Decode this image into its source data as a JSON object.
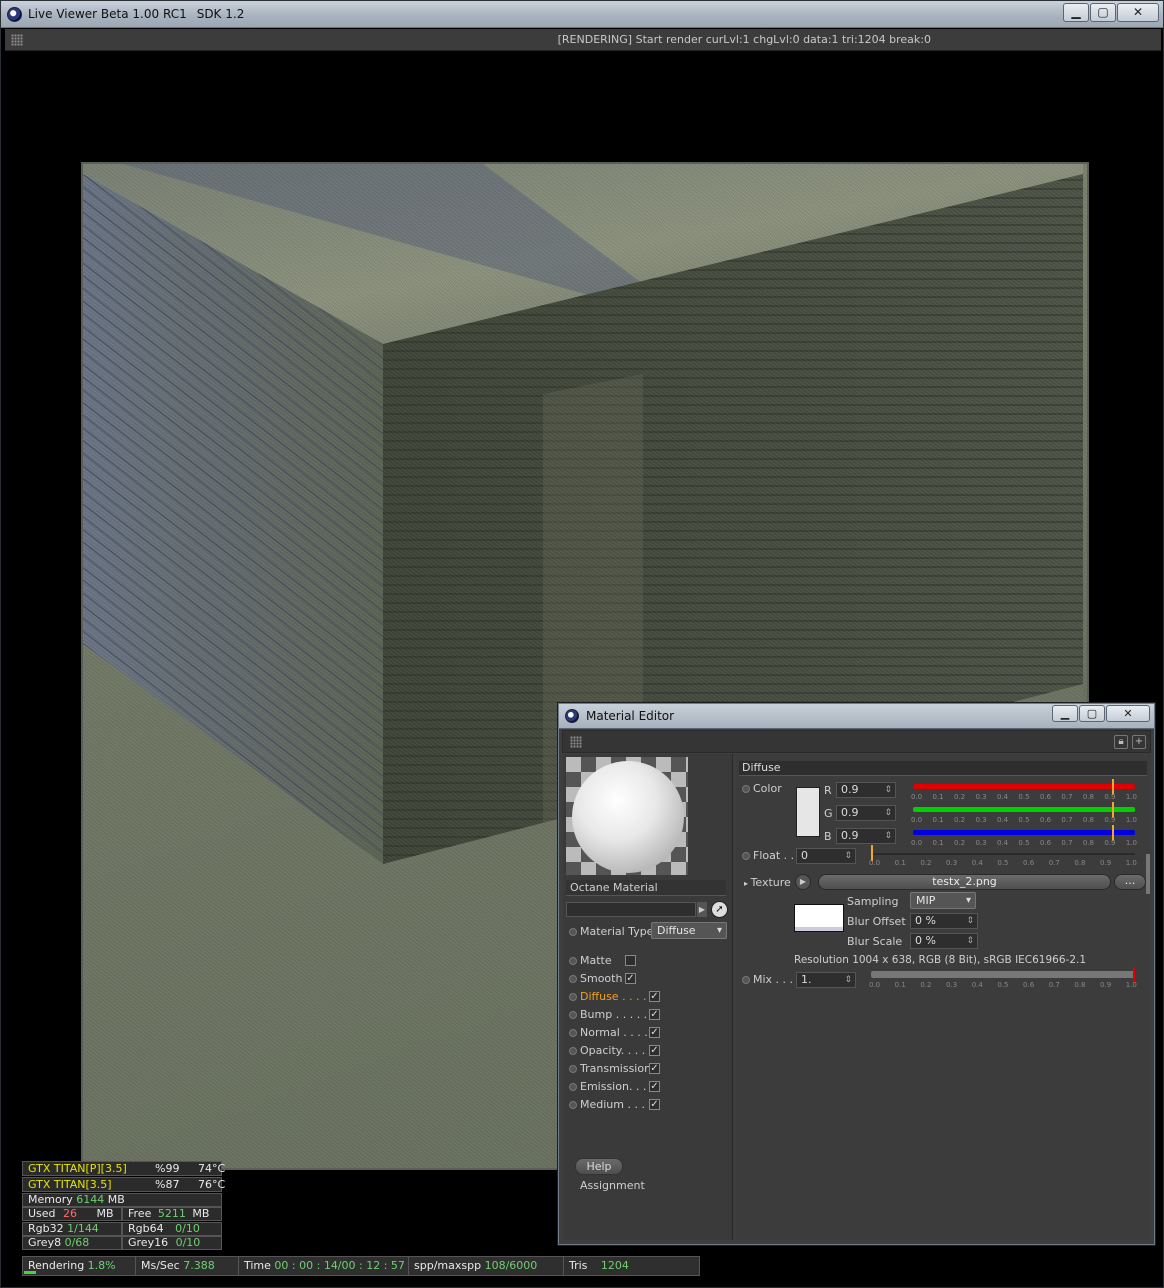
{
  "window": {
    "title": "Live Viewer Beta 1.00 RC1",
    "sdk": "SDK 1.2",
    "controls": {
      "minimize": "▁",
      "maximize": "▢",
      "close": "✕"
    }
  },
  "status": {
    "message": "[RENDERING] Start render curLvl:1 chgLvl:0 data:1 tri:1204 break:0"
  },
  "gpus": [
    {
      "name": "GTX TITAN[P][3.5]",
      "usage": "%99",
      "temp": "74°C"
    },
    {
      "name": "GTX TITAN[3.5]",
      "usage": "%87",
      "temp": "76°C"
    }
  ],
  "memory": {
    "label": "Memory",
    "total": "6144",
    "total_unit": "MB",
    "used_label": "Used",
    "used": "26",
    "used_unit": "MB",
    "free_label": "Free",
    "free": "5211",
    "free_unit": "MB"
  },
  "textures": {
    "rgb32_label": "Rgb32",
    "rgb32": "1/144",
    "rgb64_label": "Rgb64",
    "rgb64": "0/10",
    "grey8_label": "Grey8",
    "grey8": "0/68",
    "grey16_label": "Grey16",
    "grey16": "0/10"
  },
  "bottombar": {
    "rendering_label": "Rendering",
    "rendering": "1.8%",
    "mssec_label": "Ms/Sec",
    "mssec": "7.388",
    "time_label": "Time",
    "time": "00 : 00 : 14/00 : 12 : 57",
    "spp_label": "spp/maxspp",
    "spp": "108/6000",
    "tris_label": "Tris",
    "tris": "1204",
    "progress_fraction": 0.018
  },
  "material_editor": {
    "title": "Material Editor",
    "material_name": "Octane Material",
    "material_type_label": "Material Type",
    "material_type": "Diffuse",
    "channels": [
      {
        "label": "Matte",
        "checked": false
      },
      {
        "label": "Smooth",
        "checked": true
      },
      {
        "label": "Diffuse . . . . .",
        "checked": true,
        "active": true
      },
      {
        "label": "Bump . . . . . .",
        "checked": true
      },
      {
        "label": "Normal . . . . .",
        "checked": true
      },
      {
        "label": "Opacity. . . . .",
        "checked": true
      },
      {
        "label": "Transmission",
        "checked": true
      },
      {
        "label": "Emission. . . .",
        "checked": true
      },
      {
        "label": "Medium . . . .",
        "checked": true
      }
    ],
    "help_label": "Help",
    "assignment_label": "Assignment",
    "diffuse": {
      "section": "Diffuse",
      "color_label": "Color",
      "r_label": "R",
      "r": "0.9",
      "g_label": "G",
      "g": "0.9",
      "b_label": "B",
      "b": "0.9",
      "float_label": "Float . .",
      "float": "0",
      "texture_label": "Texture",
      "texture_file": "testx_2.png",
      "dots": "...",
      "sampling_label": "Sampling",
      "sampling": "MIP",
      "blur_offset_label": "Blur Offset",
      "blur_offset": "0 %",
      "blur_scale_label": "Blur Scale",
      "blur_scale": "0 %",
      "resolution": "Resolution 1004 x 638, RGB (8 Bit), sRGB IEC61966-2.1",
      "mix_label": "Mix . . .",
      "mix": "1.",
      "colors": {
        "r": "#e00000",
        "g": "#00d000",
        "b": "#0000e0",
        "knob": "#f5a623"
      }
    },
    "ticks": [
      "0.0",
      "0.1",
      "0.2",
      "0.3",
      "0.4",
      "0.5",
      "0.6",
      "0.7",
      "0.8",
      "0.9",
      "1.0"
    ]
  }
}
